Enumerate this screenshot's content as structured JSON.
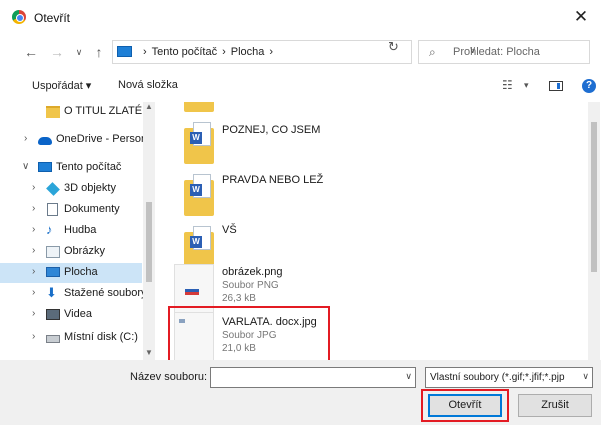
{
  "window": {
    "title": "Otevřít"
  },
  "address": {
    "crumbs": [
      "Tento počítač",
      "›",
      "Plocha",
      "›"
    ],
    "search_placeholder": "Prohledat: Plocha"
  },
  "toolbar": {
    "organize_label": "Uspořádat ▾",
    "new_folder_label": "Nová složka"
  },
  "sidebar": {
    "items": [
      {
        "label": "O TITUL ZLATÉ Ž",
        "icon": "folder-icon"
      },
      {
        "label": "OneDrive - Persor",
        "icon": "onedrive-icon"
      },
      {
        "label": "Tento počítač",
        "icon": "computer-icon"
      },
      {
        "label": "3D objekty",
        "icon": "3d-objects-icon"
      },
      {
        "label": "Dokumenty",
        "icon": "documents-icon"
      },
      {
        "label": "Hudba",
        "icon": "music-icon"
      },
      {
        "label": "Obrázky",
        "icon": "pictures-icon"
      },
      {
        "label": "Plocha",
        "icon": "desktop-icon",
        "selected": true
      },
      {
        "label": "Stažené soubory",
        "icon": "downloads-icon"
      },
      {
        "label": "Videa",
        "icon": "videos-icon"
      },
      {
        "label": "Místní disk (C:)",
        "icon": "drive-icon"
      }
    ]
  },
  "files": [
    {
      "name": "POZNEJ, CO JSEM",
      "type": "folder-word"
    },
    {
      "name": "PRAVDA NEBO LEŽ",
      "type": "folder-word"
    },
    {
      "name": "VŠ",
      "type": "folder-word"
    },
    {
      "name": "obrázek.png",
      "kind": "Soubor PNG",
      "size": "26,3 kB",
      "type": "image"
    },
    {
      "name": "VARLATA. docx.jpg",
      "kind": "Soubor JPG",
      "size": "21,0 kB",
      "type": "image",
      "highlighted": true
    }
  ],
  "footer": {
    "filename_label": "Název souboru:",
    "filename_value": "",
    "filter_value": "Vlastní soubory (*.gif;*.jfif;*.pjp",
    "open_label": "Otevřít",
    "cancel_label": "Zrušit"
  },
  "colors": {
    "highlight": "#e31b23",
    "selection": "#cce4f7",
    "accent": "#0078d7"
  }
}
